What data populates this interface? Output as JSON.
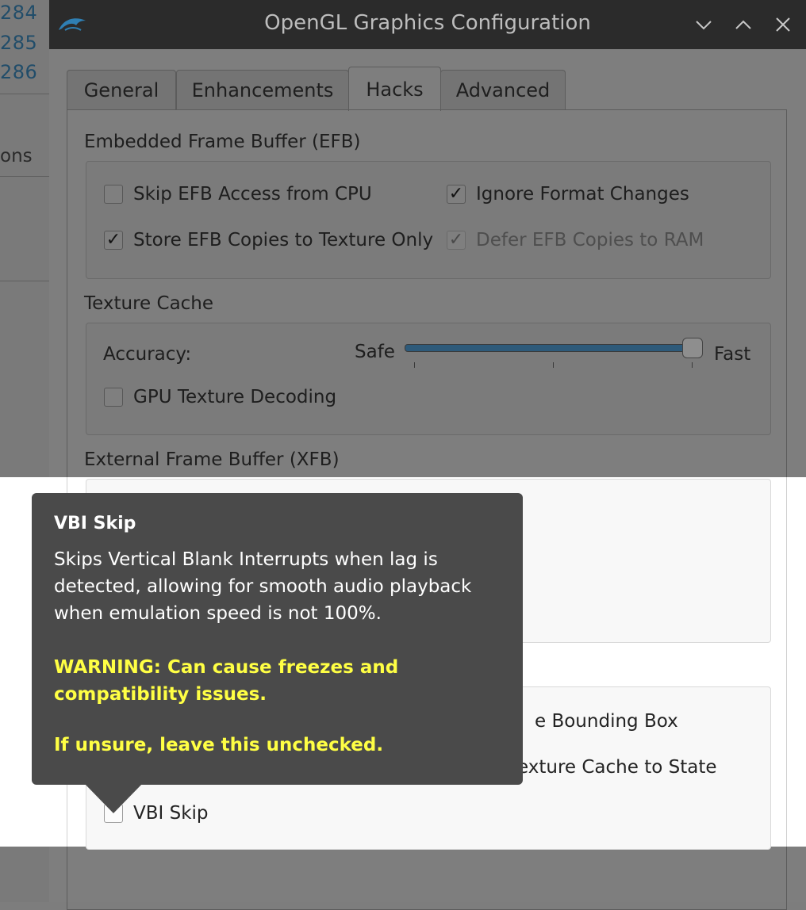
{
  "background_app": {
    "lines": [
      "284",
      "285",
      "286"
    ],
    "partial_label": "ons"
  },
  "window": {
    "title": "OpenGL Graphics Configuration",
    "controls": [
      "minimize",
      "maximize",
      "close"
    ]
  },
  "tabs": [
    {
      "label": "General",
      "active": false
    },
    {
      "label": "Enhancements",
      "active": false
    },
    {
      "label": "Hacks",
      "active": true
    },
    {
      "label": "Advanced",
      "active": false
    }
  ],
  "efb": {
    "title": "Embedded Frame Buffer (EFB)",
    "options": [
      {
        "label": "Skip EFB Access from CPU",
        "checked": false,
        "enabled": true
      },
      {
        "label": "Ignore Format Changes",
        "checked": true,
        "enabled": true
      },
      {
        "label": "Store EFB Copies to Texture Only",
        "checked": true,
        "enabled": true
      },
      {
        "label": "Defer EFB Copies to RAM",
        "checked": true,
        "enabled": false
      }
    ]
  },
  "texture_cache": {
    "title": "Texture Cache",
    "accuracy_label": "Accuracy:",
    "safe_label": "Safe",
    "fast_label": "Fast",
    "slider_value": 1.0,
    "gpu_decoding": {
      "label": "GPU Texture Decoding",
      "checked": false
    }
  },
  "xfb": {
    "title": "External Frame Buffer (XFB)"
  },
  "other": {
    "partial_bounding_box": "e Bounding Box",
    "partial_texture_cache_state": "exture Cache to State",
    "vbi_skip": {
      "label": "VBI Skip",
      "checked": false
    }
  },
  "tooltip": {
    "title": "VBI Skip",
    "body": "Skips Vertical Blank Interrupts when lag is detected, allowing for smooth audio playback when emulation speed is not 100%.",
    "warning": "WARNING: Can cause freezes and compatibility issues.",
    "advice": "If unsure, leave this unchecked."
  },
  "colors": {
    "titlebar": "#2b2b2b",
    "shade": "#7e7e7e",
    "tooltip_bg": "#4a4a4a",
    "warning_text": "#ffff44",
    "slider": "#2d5a7a"
  }
}
